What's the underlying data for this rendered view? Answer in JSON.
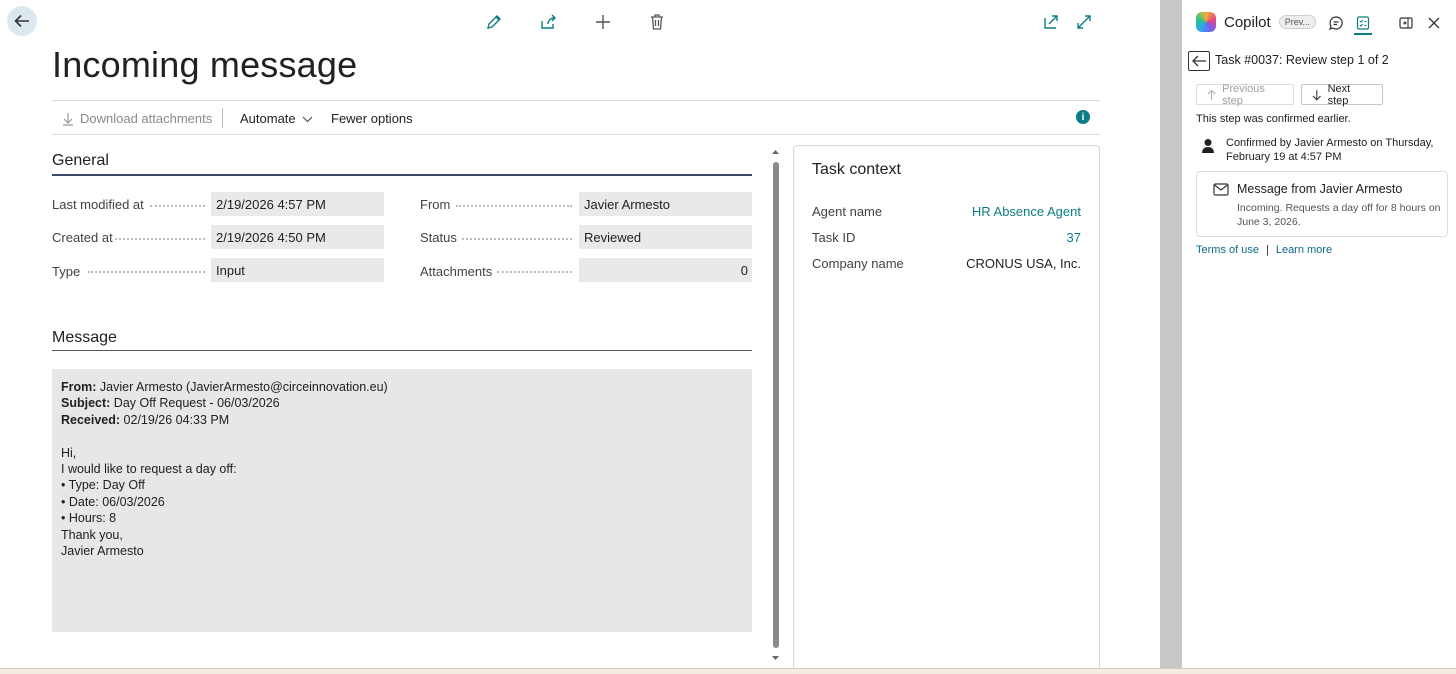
{
  "page": {
    "title": "Incoming message"
  },
  "actions": {
    "download": "Download attachments",
    "automate": "Automate",
    "fewer": "Fewer options"
  },
  "general": {
    "title": "General",
    "fields": {
      "last_modified_label": "Last modified at",
      "last_modified_value": "2/19/2026 4:57 PM",
      "created_label": "Created at",
      "created_value": "2/19/2026 4:50 PM",
      "type_label": "Type",
      "type_value": "Input",
      "from_label": "From",
      "from_value": "Javier Armesto",
      "status_label": "Status",
      "status_value": "Reviewed",
      "attachments_label": "Attachments",
      "attachments_value": "0"
    }
  },
  "message": {
    "title": "Message",
    "from_key": "From:",
    "from_val": " Javier Armesto (JavierArmesto@circeinnovation.eu)",
    "subject_key": "Subject:",
    "subject_val": " Day Off Request - 06/03/2026",
    "received_key": "Received:",
    "received_val": " 02/19/26 04:33 PM",
    "body": [
      "Hi,",
      "I would like to request a day off:",
      "• Type: Day Off",
      "• Date: 06/03/2026",
      "• Hours: 8",
      "Thank you,",
      "Javier Armesto"
    ]
  },
  "task_context": {
    "title": "Task context",
    "agent_label": "Agent name",
    "agent_value": "HR Absence Agent",
    "taskid_label": "Task ID",
    "taskid_value": "37",
    "company_label": "Company name",
    "company_value": "CRONUS USA, Inc."
  },
  "copilot": {
    "name": "Copilot",
    "badge": "Prev...",
    "task_title": "Task #0037: Review step 1 of 2",
    "prev_step": "Previous step",
    "next_step": "Next step",
    "note": "This step was confirmed earlier.",
    "confirmed": "Confirmed by Javier Armesto on Thursday, February 19 at 4:57 PM",
    "card_title": "Message from Javier Armesto",
    "card_desc": "Incoming. Requests a day off for 8 hours on June 3, 2026.",
    "terms": "Terms of use",
    "separator": "|",
    "learn": "Learn more"
  },
  "colors": {
    "accent": "#0b7d84",
    "field_bg": "#e8e9ea",
    "section_line": "#3a4a6b"
  }
}
